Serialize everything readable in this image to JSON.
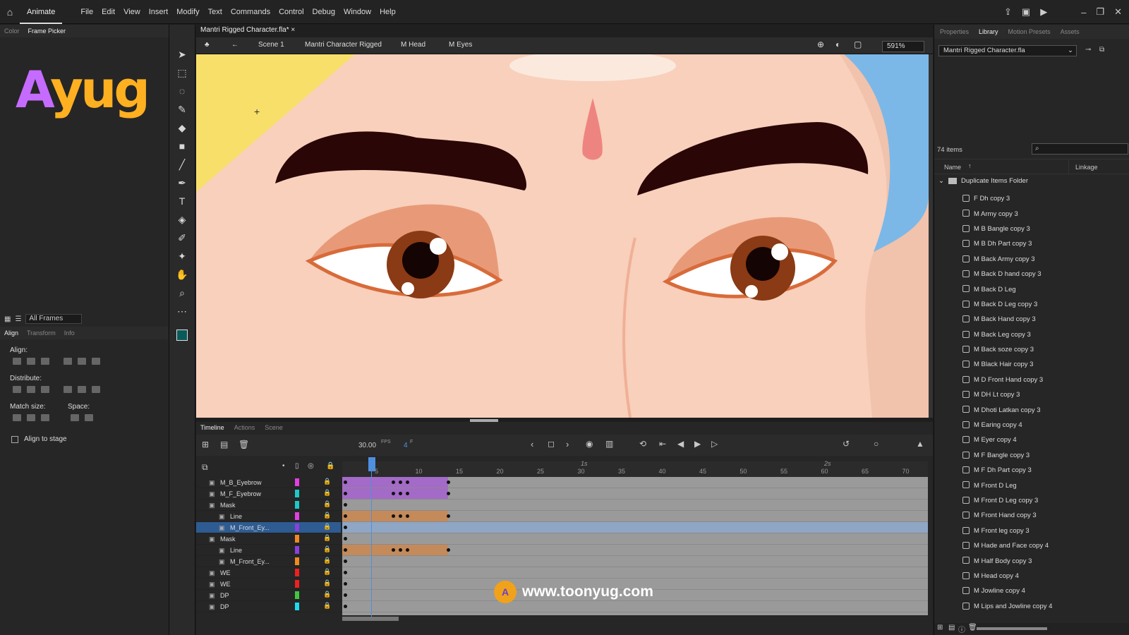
{
  "menubar": {
    "app_name": "Animate",
    "items": [
      "File",
      "Edit",
      "View",
      "Insert",
      "Modify",
      "Text",
      "Commands",
      "Control",
      "Debug",
      "Window",
      "Help"
    ]
  },
  "left_panel": {
    "tabs": [
      "Color",
      "Frame Picker"
    ],
    "frames_filter": "All Frames",
    "align_tabs": [
      "Align",
      "Transform",
      "Info"
    ],
    "align_label": "Align:",
    "distribute_label": "Distribute:",
    "match_size_label": "Match size:",
    "space_label": "Space:",
    "align_to_stage": "Align to stage"
  },
  "document": {
    "tab_title": "Mantri Rigged Character.fla*",
    "breadcrumbs": [
      "Scene 1",
      "Mantri Character Rigged",
      "M Head",
      "M Eyes"
    ],
    "zoom": "591%"
  },
  "timeline": {
    "tabs": [
      "Timeline",
      "Actions",
      "Scene"
    ],
    "fps": "30.00",
    "fps_unit": "FPS",
    "frame": "4",
    "frame_unit": "F",
    "ruler_marks": [
      "5",
      "10",
      "15",
      "20",
      "25",
      "30",
      "35",
      "40",
      "45",
      "50",
      "55",
      "60",
      "65",
      "70"
    ],
    "time_marks": [
      "1s",
      "2s"
    ],
    "layers": [
      {
        "name": "M_B_Eyebrow",
        "color": "#e040e0",
        "indent": 0,
        "selected": false
      },
      {
        "name": "M_F_Eyebrow",
        "color": "#1fc8c8",
        "indent": 0,
        "selected": false
      },
      {
        "name": "Mask",
        "color": "#1fc8c8",
        "indent": 0,
        "selected": false
      },
      {
        "name": "Line",
        "color": "#e040e0",
        "indent": 1,
        "selected": false
      },
      {
        "name": "M_Front_Ey...",
        "color": "#8a3fe0",
        "indent": 1,
        "selected": true
      },
      {
        "name": "Mask",
        "color": "#f08a20",
        "indent": 0,
        "selected": false
      },
      {
        "name": "Line",
        "color": "#8a3fe0",
        "indent": 1,
        "selected": false
      },
      {
        "name": "M_Front_Ey...",
        "color": "#f08a20",
        "indent": 1,
        "selected": false
      },
      {
        "name": "WE",
        "color": "#f02020",
        "indent": 0,
        "selected": false
      },
      {
        "name": "WE",
        "color": "#f02020",
        "indent": 0,
        "selected": false
      },
      {
        "name": "DP",
        "color": "#3fc83f",
        "indent": 0,
        "selected": false
      },
      {
        "name": "DP",
        "color": "#20d8f0",
        "indent": 0,
        "selected": false
      }
    ]
  },
  "right_panel": {
    "tabs": [
      "Properties",
      "Library",
      "Motion Presets",
      "Assets"
    ],
    "library_file": "Mantri Rigged Character.fla",
    "item_count": "74 items",
    "col_name": "Name",
    "col_linkage": "Linkage",
    "folder": "Duplicate Items Folder",
    "items": [
      "F Dh copy 3",
      "M Army copy 3",
      "M B Bangle copy 3",
      "M B Dh Part copy 3",
      "M Back Army copy 3",
      "M Back D hand copy 3",
      "M Back D Leg",
      "M Back D Leg copy 3",
      "M Back Hand copy 3",
      "M Back Leg copy 3",
      "M Back soze copy 3",
      "M Black Hair copy 3",
      "M D Front Hand copy 3",
      "M DH Lt copy 3",
      "M Dhoti Latkan copy 3",
      "M Earing copy 4",
      "M Eyer copy 4",
      "M F Bangle copy 3",
      "M F Dh Part copy 3",
      "M Front D Leg",
      "M Front D Leg copy 3",
      "M Front Hand copy 3",
      "M Front leg copy 3",
      "M Hade and Face copy 4",
      "M Half Body copy 3",
      "M Head copy 4",
      "M Jowline copy 4",
      "M Lips and Jowline copy 4"
    ]
  },
  "watermark": {
    "logo": "Ayug",
    "url": "www.toonyug.com"
  },
  "colors": {
    "accent": "#4f8fe0",
    "skin": "#f8d0bc",
    "brow": "#2a0606",
    "iris": "#8a3a14",
    "lid": "#e89a78"
  }
}
